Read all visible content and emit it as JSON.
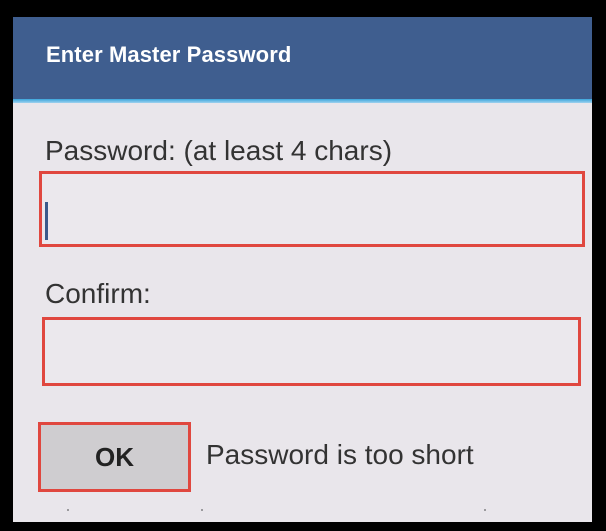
{
  "dialog": {
    "title": "Enter Master Password",
    "password_label": "Password: (at least 4 chars)",
    "password_value": "",
    "confirm_label": "Confirm:",
    "confirm_value": "",
    "ok_label": "OK",
    "status_message": "Password is too short"
  },
  "colors": {
    "title_bar": "#3f5e8f",
    "title_accent": "#3aa6dc",
    "dialog_background": "#e9e6eb",
    "highlight_border": "#e0473f",
    "button_background": "#cfcdd0"
  }
}
